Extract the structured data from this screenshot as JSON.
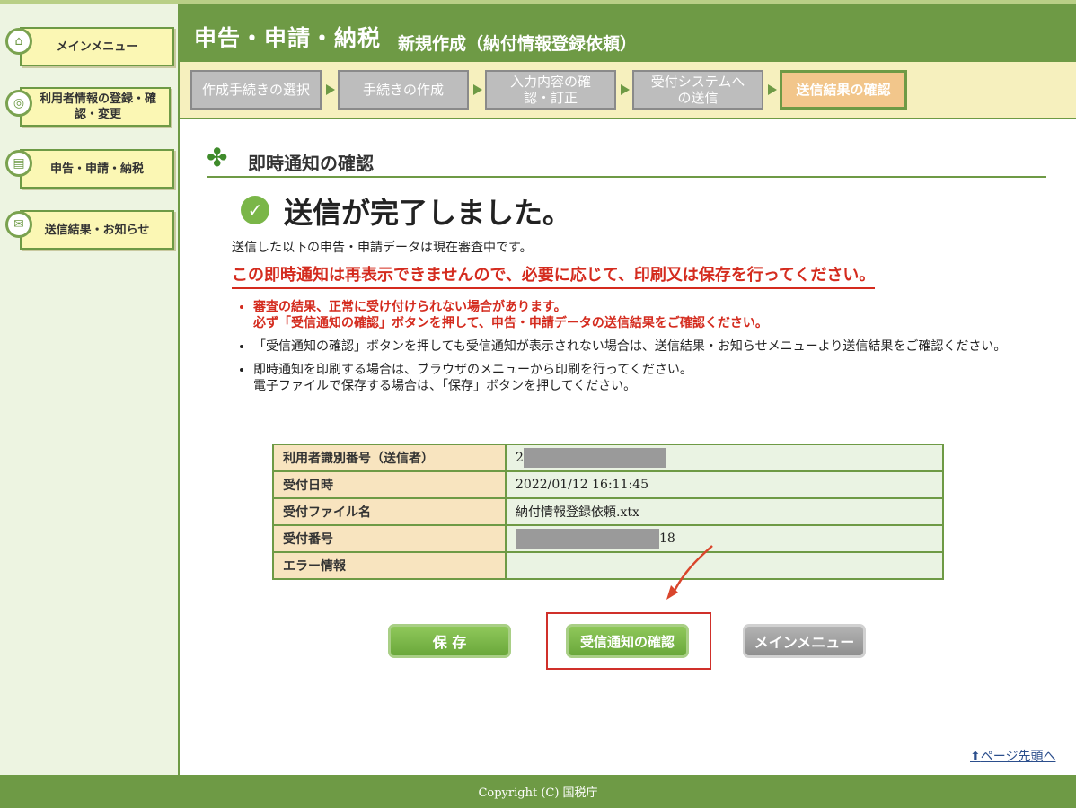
{
  "sidebar": {
    "items": [
      {
        "label": "メインメニュー",
        "icon": "home-icon"
      },
      {
        "label": "利用者情報の登録・確認・変更",
        "icon": "user-settings-icon"
      },
      {
        "label": "申告・申請・納税",
        "icon": "document-icon"
      },
      {
        "label": "送信結果・お知らせ",
        "icon": "notice-icon"
      }
    ]
  },
  "header": {
    "title": "申告・申請・納税",
    "subtitle": "新規作成（納付情報登録依頼）"
  },
  "steps": [
    {
      "label": "作成手続きの選択",
      "active": false
    },
    {
      "label": "手続きの作成",
      "active": false
    },
    {
      "label": "入力内容の確認・訂正",
      "active": false
    },
    {
      "label": "受付システムへの送信",
      "active": false
    },
    {
      "label": "送信結果の確認",
      "active": true
    }
  ],
  "section": {
    "title": "即時通知の確認"
  },
  "status": {
    "message": "送信が完了しました。"
  },
  "intro": "送信した以下の申告・申請データは現在審査中です。",
  "warning": "この即時通知は再表示できませんので、必要に応じて、印刷又は保存を行ってください。",
  "notes": [
    {
      "line1": "審査の結果、正常に受け付けられない場合があります。",
      "line2": "必ず「受信通知の確認」ボタンを押して、申告・申請データの送信結果をご確認ください。"
    },
    {
      "line1": "「受信通知の確認」ボタンを押しても受信通知が表示されない場合は、送信結果・お知らせメニューより送信結果をご確認ください。",
      "line2": ""
    },
    {
      "line1": "即時通知を印刷する場合は、ブラウザのメニューから印刷を行ってください。",
      "line2": "電子ファイルで保存する場合は、「保存」ボタンを押してください。"
    }
  ],
  "table": {
    "rows": [
      {
        "label": "利用者識別番号（送信者）",
        "value_prefix": "2",
        "value_suffix": ""
      },
      {
        "label": "受付日時",
        "value_prefix": "2022/01/12 16:11:45",
        "value_suffix": ""
      },
      {
        "label": "受付ファイル名",
        "value_prefix": "納付情報登録依頼.xtx",
        "value_suffix": ""
      },
      {
        "label": "受付番号",
        "value_prefix": "",
        "value_suffix": "18"
      },
      {
        "label": "エラー情報",
        "value_prefix": "",
        "value_suffix": ""
      }
    ]
  },
  "buttons": {
    "save": "保 存",
    "check_notice": "受信通知の確認",
    "main_menu": "メインメニュー"
  },
  "page_top": "ページ先頭へ",
  "footer": "Copyright (C) 国税庁",
  "colors": {
    "brand_green": "#6e9a45",
    "warning_red": "#d42b1e",
    "active_step": "#f2c68b"
  }
}
